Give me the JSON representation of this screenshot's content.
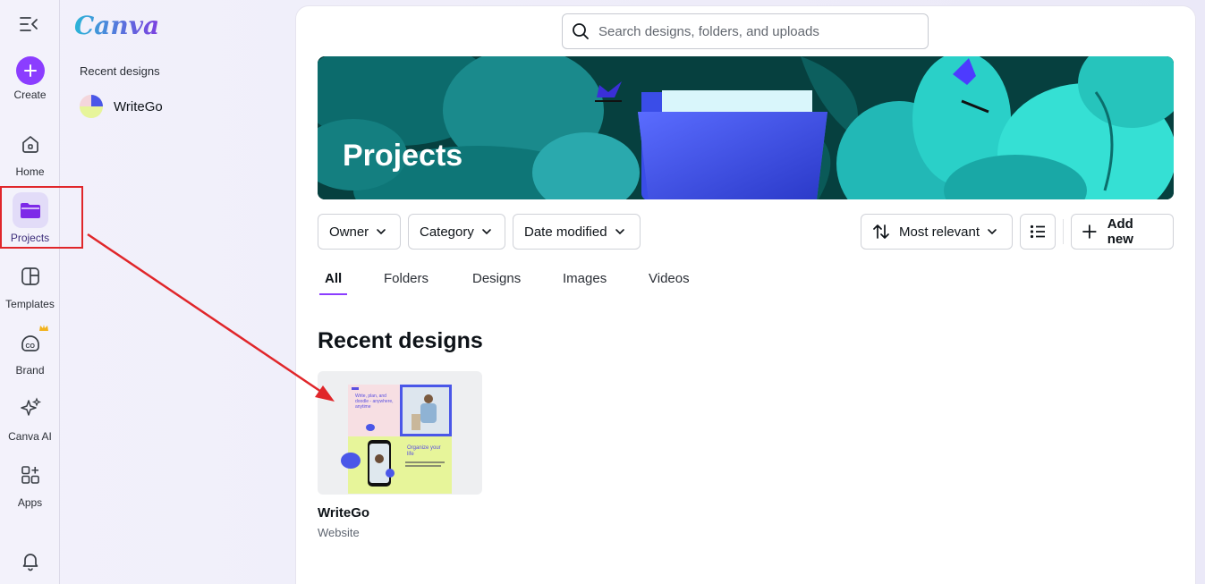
{
  "rail": {
    "create_label": "Create",
    "items": [
      {
        "label": "Home",
        "icon": "home-icon"
      },
      {
        "label": "Projects",
        "icon": "folder-icon"
      },
      {
        "label": "Templates",
        "icon": "templates-icon"
      },
      {
        "label": "Brand",
        "icon": "brand-icon"
      },
      {
        "label": "Canva AI",
        "icon": "sparkle-icon"
      },
      {
        "label": "Apps",
        "icon": "apps-icon"
      }
    ]
  },
  "side_panel": {
    "logo": "Canva",
    "heading": "Recent designs",
    "recent": [
      {
        "name": "WriteGo"
      }
    ]
  },
  "search": {
    "placeholder": "Search designs, folders, and uploads"
  },
  "banner": {
    "title": "Projects"
  },
  "filters": {
    "owner": "Owner",
    "category": "Category",
    "date_modified": "Date modified",
    "sort": "Most relevant",
    "add_new": "Add new"
  },
  "tabs": [
    {
      "label": "All",
      "active": true
    },
    {
      "label": "Folders"
    },
    {
      "label": "Designs"
    },
    {
      "label": "Images"
    },
    {
      "label": "Videos"
    }
  ],
  "section_title": "Recent designs",
  "designs": [
    {
      "name": "WriteGo",
      "type": "Website",
      "thumb_text_1": "Write, plan, and doodle - anywhere, anytime",
      "thumb_text_2": "Organize your life"
    }
  ],
  "colors": {
    "accent": "#8b3dff",
    "annotation": "#e0262a"
  }
}
